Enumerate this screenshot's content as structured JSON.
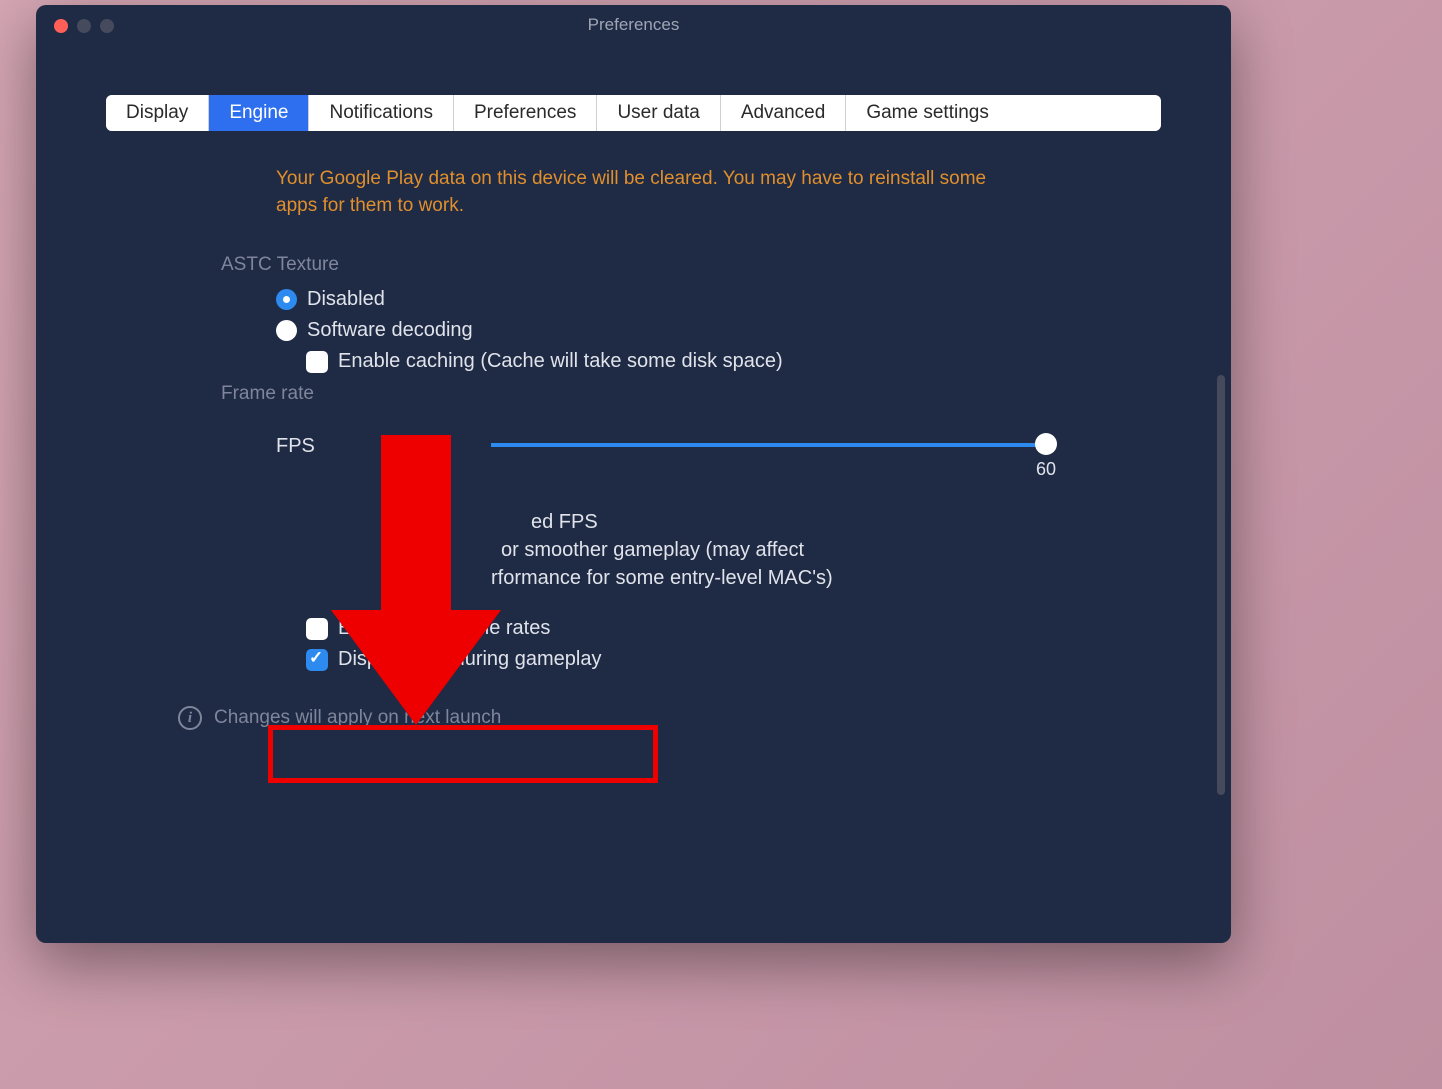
{
  "window": {
    "title": "Preferences"
  },
  "tabs": {
    "display": "Display",
    "engine": "Engine",
    "notifications": "Notifications",
    "preferences": "Preferences",
    "user_data": "User data",
    "advanced": "Advanced",
    "game_settings": "Game settings"
  },
  "warning": "Your Google Play data on this device will be cleared. You may have to reinstall some apps for them to work.",
  "astc": {
    "section_label": "ASTC Texture",
    "disabled": "Disabled",
    "software_decoding": "Software decoding",
    "enable_caching": "Enable caching (Cache will take some disk space)"
  },
  "frame_rate": {
    "section_label": "Frame rate",
    "fps_label": "FPS",
    "fps_value": "60",
    "partial_line1": "ed FPS",
    "partial_line2": "or smoother gameplay (may affect",
    "partial_line3": "rformance for some entry-level MAC's)",
    "enable_high_fr": "Enable high frame rates",
    "display_fps": "Display FPS during gameplay"
  },
  "footer": {
    "text": "Changes will apply on next launch"
  }
}
